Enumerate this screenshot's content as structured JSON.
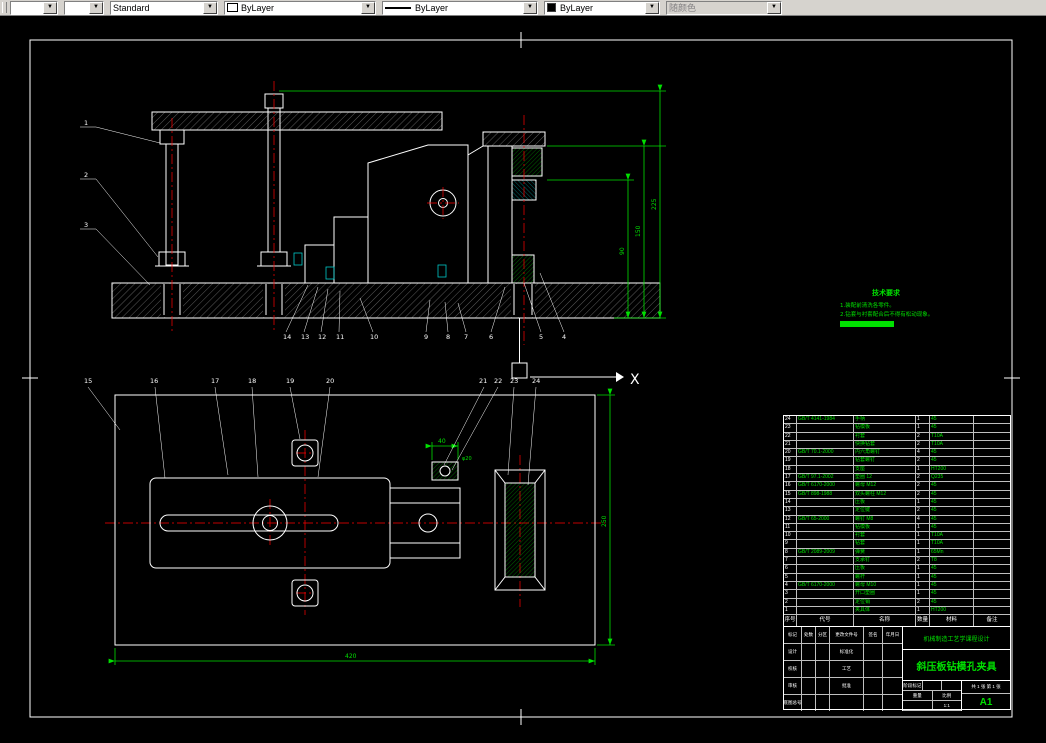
{
  "toolbar": {
    "combo_a": "",
    "combo_b": "",
    "style": "Standard",
    "linetype": "ByLayer",
    "lineweight": "ByLayer",
    "color": "ByLayer",
    "plot_style": "随颜色"
  },
  "axis_label": "X",
  "notes": {
    "title": "技术要求",
    "lines": [
      "1.装配前清洗各零件。",
      "2.钻套与衬套配合后不得有松动现象。"
    ]
  },
  "dims": {
    "front": [
      "225",
      "150",
      "90"
    ],
    "top_width": "420",
    "top_depth": "250",
    "top_small": "40",
    "top_dia": "φ20"
  },
  "balloons": {
    "front_left": [
      "1",
      "2",
      "3"
    ],
    "front_bottom": [
      "14",
      "13",
      "12",
      "11",
      "10",
      "9",
      "8",
      "7",
      "6",
      "5",
      "4"
    ],
    "top_upper": [
      "15",
      "16",
      "17",
      "18",
      "19",
      "20"
    ],
    "top_right": [
      "21",
      "22",
      "23",
      "24"
    ]
  },
  "title_block": {
    "org": "机械制造工艺学课程设计",
    "drawing_title": "斜压板钻模孔夹具",
    "sheet_size": "A1",
    "scale_value": "1:1",
    "weight_label": "重量",
    "scale_label": "比例",
    "stage_label": "阶段标记",
    "sheet_info": "共 1 张 第 1 张",
    "sig_rows": [
      [
        "标记",
        "处数",
        "分区",
        "更改文件号",
        "签名",
        "年月日"
      ],
      [
        "设计",
        "",
        "",
        "标准化",
        "",
        ""
      ],
      [
        "校核",
        "",
        "",
        "工艺",
        "",
        ""
      ],
      [
        "审核",
        "",
        "",
        "批准",
        "",
        ""
      ],
      [
        "底图总号",
        "",
        "",
        "",
        "",
        ""
      ]
    ]
  },
  "bom": {
    "headers": [
      "序号",
      "代号",
      "名称",
      "数量",
      "材料",
      "备注"
    ],
    "rows": [
      {
        "no": "24",
        "code": "GB/T 4141-1984",
        "name": "手柄",
        "qty": "1",
        "mat": "45",
        "rem": ""
      },
      {
        "no": "23",
        "code": "",
        "name": "钻模板",
        "qty": "1",
        "mat": "45",
        "rem": ""
      },
      {
        "no": "22",
        "code": "",
        "name": "衬套",
        "qty": "2",
        "mat": "T10A",
        "rem": ""
      },
      {
        "no": "21",
        "code": "",
        "name": "快换钻套",
        "qty": "2",
        "mat": "T10A",
        "rem": ""
      },
      {
        "no": "20",
        "code": "GB/T 70.1-2000",
        "name": "内六角螺钉",
        "qty": "4",
        "mat": "45",
        "rem": ""
      },
      {
        "no": "19",
        "code": "",
        "name": "钻套螺钉",
        "qty": "2",
        "mat": "45",
        "rem": ""
      },
      {
        "no": "18",
        "code": "",
        "name": "支座",
        "qty": "1",
        "mat": "HT200",
        "rem": ""
      },
      {
        "no": "17",
        "code": "GB/T 97.1-2002",
        "name": "垫圈 12",
        "qty": "2",
        "mat": "Q235",
        "rem": ""
      },
      {
        "no": "16",
        "code": "GB/T 6170-2000",
        "name": "螺母 M12",
        "qty": "2",
        "mat": "45",
        "rem": ""
      },
      {
        "no": "15",
        "code": "GB/T 898-1988",
        "name": "双头螺柱 M12",
        "qty": "2",
        "mat": "45",
        "rem": ""
      },
      {
        "no": "14",
        "code": "",
        "name": "压板",
        "qty": "1",
        "mat": "45",
        "rem": ""
      },
      {
        "no": "13",
        "code": "",
        "name": "定位键",
        "qty": "2",
        "mat": "45",
        "rem": ""
      },
      {
        "no": "12",
        "code": "GB/T 65-2000",
        "name": "螺钉 M8",
        "qty": "4",
        "mat": "45",
        "rem": ""
      },
      {
        "no": "11",
        "code": "",
        "name": "钻模板",
        "qty": "1",
        "mat": "45",
        "rem": ""
      },
      {
        "no": "10",
        "code": "",
        "name": "衬套",
        "qty": "1",
        "mat": "T10A",
        "rem": ""
      },
      {
        "no": "9",
        "code": "",
        "name": "钻套",
        "qty": "1",
        "mat": "T10A",
        "rem": ""
      },
      {
        "no": "8",
        "code": "GB/T 2089-2009",
        "name": "弹簧",
        "qty": "1",
        "mat": "65Mn",
        "rem": ""
      },
      {
        "no": "7",
        "code": "",
        "name": "支承钉",
        "qty": "2",
        "mat": "T8",
        "rem": ""
      },
      {
        "no": "6",
        "code": "",
        "name": "压板",
        "qty": "1",
        "mat": "45",
        "rem": ""
      },
      {
        "no": "5",
        "code": "",
        "name": "螺杆",
        "qty": "1",
        "mat": "45",
        "rem": ""
      },
      {
        "no": "4",
        "code": "GB/T 6170-2000",
        "name": "螺母 M10",
        "qty": "1",
        "mat": "45",
        "rem": ""
      },
      {
        "no": "3",
        "code": "",
        "name": "开口垫圈",
        "qty": "1",
        "mat": "45",
        "rem": ""
      },
      {
        "no": "2",
        "code": "",
        "name": "定位销",
        "qty": "2",
        "mat": "45",
        "rem": ""
      },
      {
        "no": "1",
        "code": "",
        "name": "夹具体",
        "qty": "1",
        "mat": "HT200",
        "rem": ""
      }
    ]
  }
}
